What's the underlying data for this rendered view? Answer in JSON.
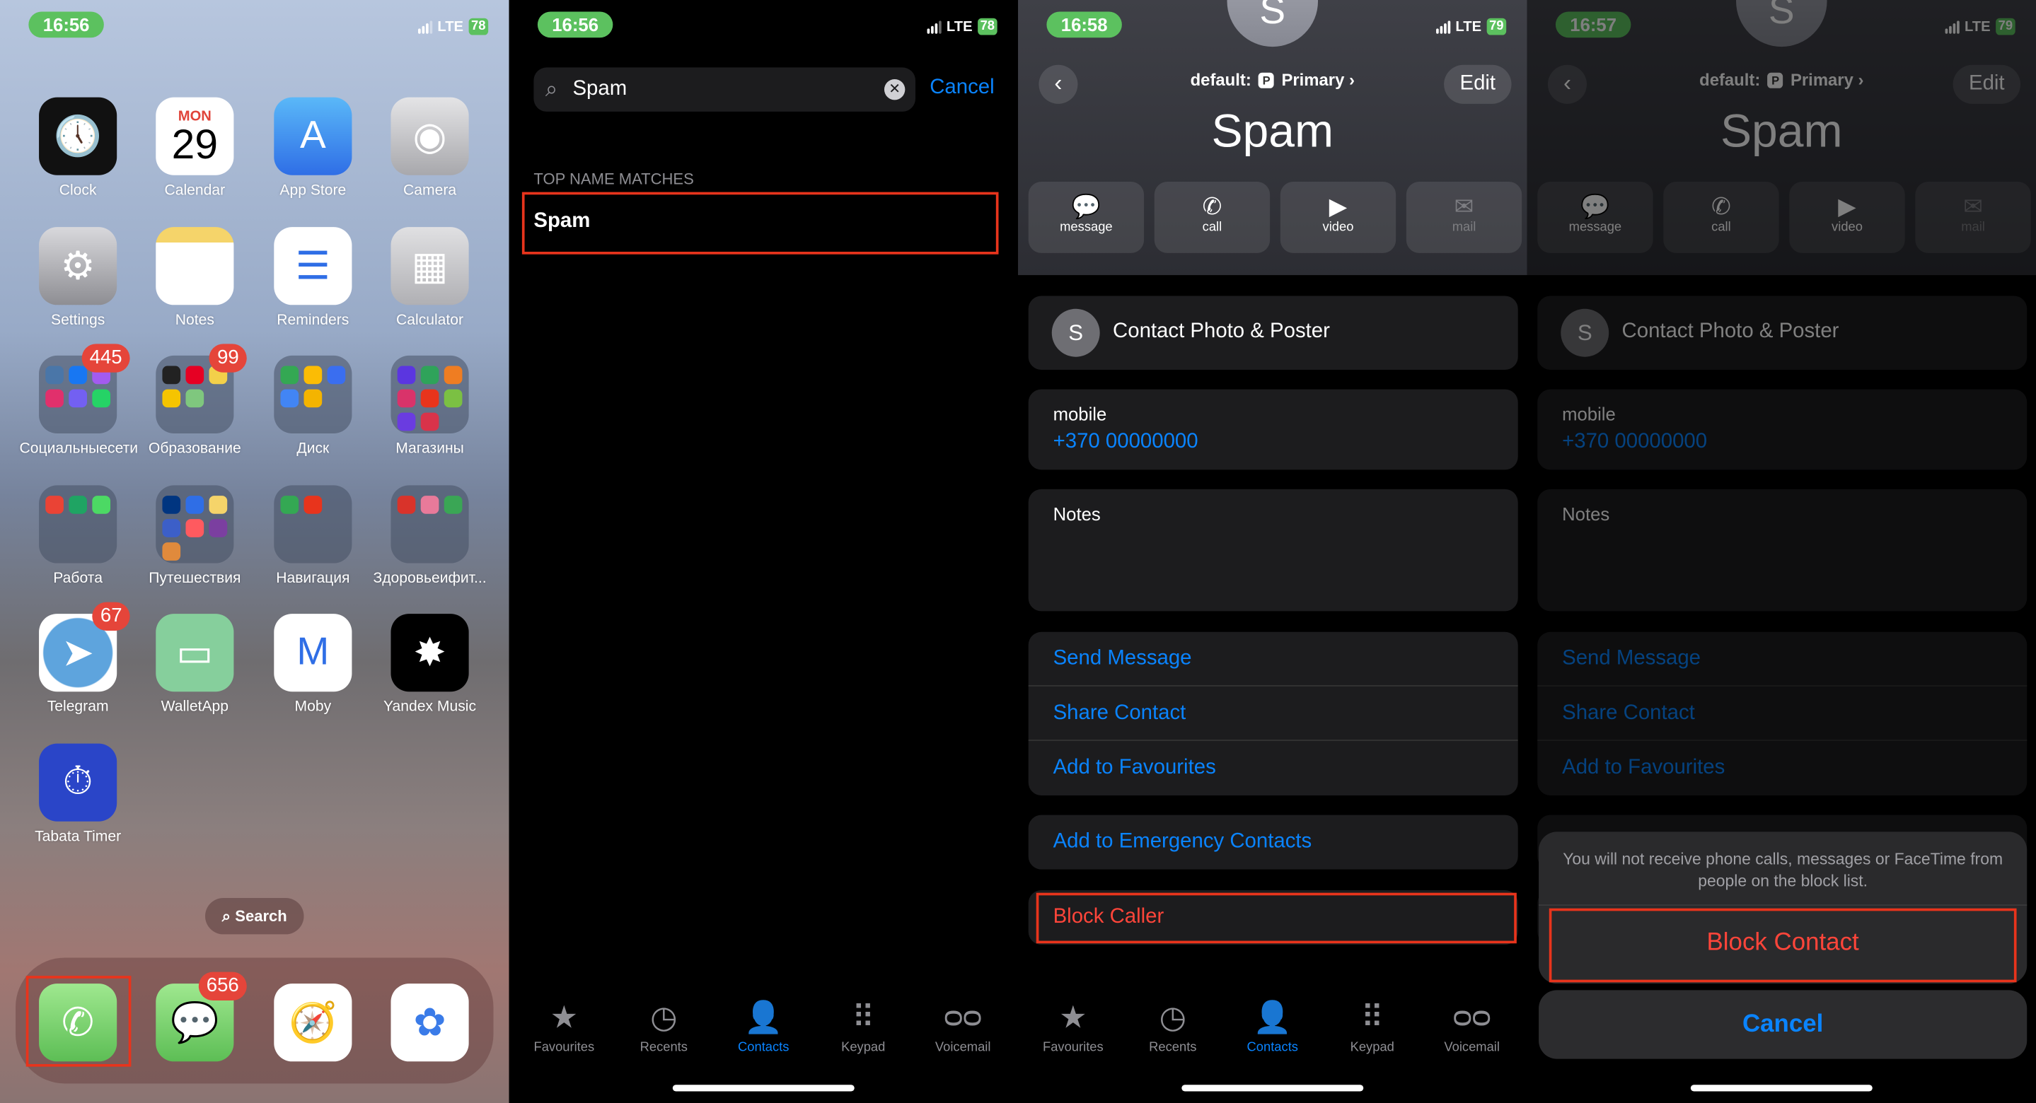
{
  "home": {
    "time": "16:56",
    "network": "LTE",
    "battery": "78",
    "apps": [
      {
        "label": "Clock",
        "icon": "clock-icon",
        "glyph": "🕔",
        "bg": "#111"
      },
      {
        "label": "Calendar",
        "icon": "calendar-icon",
        "day": "MON",
        "date": "29",
        "bg": "#fff"
      },
      {
        "label": "App Store",
        "icon": "app-store-icon",
        "glyph": "A",
        "bg": "linear-gradient(#5ab8f8,#2f6ee6)"
      },
      {
        "label": "Camera",
        "icon": "camera-icon",
        "glyph": "◉",
        "bg": "linear-gradient(#e4e4e6,#a8a8ac)"
      },
      {
        "label": "Settings",
        "icon": "settings-gear-icon",
        "glyph": "⚙",
        "bg": "linear-gradient(#d8d8dc,#8e8e93)"
      },
      {
        "label": "Notes",
        "icon": "notes-icon",
        "glyph": "",
        "bg": "linear-gradient(#f5d46a 0 20%,#fff 20%)"
      },
      {
        "label": "Reminders",
        "icon": "reminders-icon",
        "glyph": "☰",
        "bg": "#fff"
      },
      {
        "label": "Calculator",
        "icon": "calculator-icon",
        "glyph": "▦",
        "bg": "linear-gradient(#e0e0e2,#b0b0b4)"
      },
      {
        "label": "Социальныесети",
        "icon": "folder-icon",
        "badge": "445",
        "folder": [
          "#4a76a8",
          "#1877f2",
          "#a35bf0",
          "#e1306c",
          "#7360f2",
          "#25d366"
        ]
      },
      {
        "label": "Образование",
        "icon": "folder-icon",
        "badge": "99",
        "folder": [
          "#222",
          "#e60023",
          "#f3d04a",
          "#f5c400",
          "#7fc77e"
        ]
      },
      {
        "label": "Диск",
        "icon": "folder-icon",
        "folder": [
          "#34a853",
          "#fbbc05",
          "#3a6ef0",
          "#4285f4",
          "#f4b400"
        ]
      },
      {
        "label": "Магазины",
        "icon": "folder-icon",
        "folder": [
          "#5b36e0",
          "#2fa35a",
          "#ef7d22",
          "#d9336a",
          "#e8341c",
          "#7bc043",
          "#6a3ce0",
          "#d9334a"
        ]
      },
      {
        "label": "Работа",
        "icon": "folder-icon",
        "folder": [
          "#ea4335",
          "#1fa463",
          "#4cd964"
        ]
      },
      {
        "label": "Путешествия",
        "icon": "folder-icon",
        "folder": [
          "#003580",
          "#2f6ee6",
          "#f5d46a",
          "#3c5fc8",
          "#ff5a5f",
          "#7b3fa0",
          "#e08a3c"
        ]
      },
      {
        "label": "Навигация",
        "icon": "folder-icon",
        "folder": [
          "#34a853",
          "#e8341c"
        ]
      },
      {
        "label": "Здоровьеифит...",
        "icon": "folder-icon",
        "folder": [
          "#d9332a",
          "#e87a9a",
          "#3aa655"
        ]
      },
      {
        "label": "Telegram",
        "icon": "telegram-icon",
        "badge": "67",
        "glyph": "➤",
        "bg": "radial-gradient(circle,#5ea4dd 62%,#fff 64%)"
      },
      {
        "label": "WalletApp",
        "icon": "wallet-icon",
        "glyph": "▭",
        "bg": "#86cf9c"
      },
      {
        "label": "Moby",
        "icon": "moby-icon",
        "glyph": "M",
        "bg": "#fff"
      },
      {
        "label": "Yandex Music",
        "icon": "yandex-music-icon",
        "glyph": "✸",
        "bg": "#000"
      },
      {
        "label": "Tabata Timer",
        "icon": "stopwatch-icon",
        "glyph": "⏱",
        "bg": "#2a45c8"
      }
    ],
    "search_label": "Search",
    "dock": [
      {
        "name": "phone",
        "icon": "phone-icon",
        "glyph": "✆",
        "bg": "linear-gradient(#9fe88f,#5dbe55)"
      },
      {
        "name": "messages",
        "icon": "messages-icon",
        "glyph": "💬",
        "bg": "linear-gradient(#9fe88f,#5dbe55)",
        "badge": "656"
      },
      {
        "name": "safari",
        "icon": "safari-compass-icon",
        "glyph": "🧭",
        "bg": "#fff"
      },
      {
        "name": "photos",
        "icon": "photos-icon",
        "glyph": "✿",
        "bg": "#fff"
      }
    ]
  },
  "search_screen": {
    "time": "16:56",
    "network": "LTE",
    "battery": "78",
    "query": "Spam",
    "cancel": "Cancel",
    "section": "TOP NAME MATCHES",
    "result": "Spam"
  },
  "tabs": [
    {
      "label": "Favourites",
      "icon": "star-icon",
      "glyph": "★"
    },
    {
      "label": "Recents",
      "icon": "clock-icon",
      "glyph": "◷"
    },
    {
      "label": "Contacts",
      "icon": "person-circle-icon",
      "glyph": "👤",
      "active": true
    },
    {
      "label": "Keypad",
      "icon": "keypad-icon",
      "glyph": "⠿"
    },
    {
      "label": "Voicemail",
      "icon": "voicemail-icon",
      "glyph": "ᴑᴑ"
    }
  ],
  "contact": {
    "avatar_letter": "S",
    "account_prefix": "default:",
    "account_badge": "P",
    "account": "Primary",
    "edit": "Edit",
    "name": "Spam",
    "actions": [
      {
        "label": "message",
        "glyph": "💬"
      },
      {
        "label": "call",
        "glyph": "✆"
      },
      {
        "label": "video",
        "glyph": "▶"
      },
      {
        "label": "mail",
        "glyph": "✉",
        "disabled": true
      }
    ],
    "photo_poster": "Contact Photo & Poster",
    "phone_label": "mobile",
    "phone": "+370 00000000",
    "notes": "Notes",
    "links": [
      "Send Message",
      "Share Contact",
      "Add to Favourites"
    ],
    "emergency": "Add to Emergency Contacts",
    "block": "Block Caller"
  },
  "contact_screen_time": "16:58",
  "block_screen": {
    "time": "16:57",
    "battery": "79",
    "message": "You will not receive phone calls, messages or FaceTime from people on the block list.",
    "confirm": "Block Contact",
    "cancel": "Cancel"
  },
  "colors": {
    "accent": "#0a84ff",
    "destructive": "#ff453a",
    "highlight": "#e8341c",
    "status_green": "#5cc15f"
  }
}
